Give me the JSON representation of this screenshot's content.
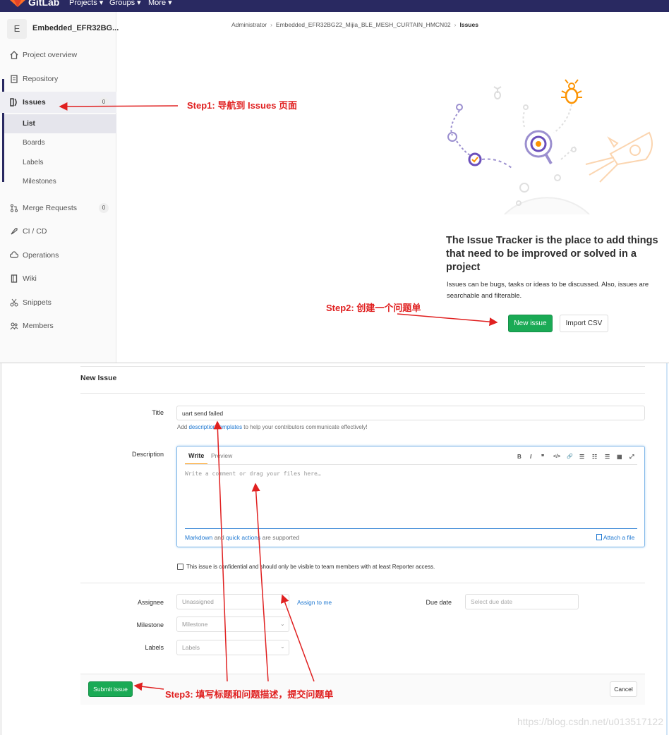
{
  "topnav": {
    "brand": "GitLab",
    "links": [
      "Projects ▾",
      "Groups ▾",
      "More ▾"
    ]
  },
  "sidebar": {
    "project_avatar": "E",
    "project_name": "Embedded_EFR32BG...",
    "items": [
      {
        "label": "Project overview"
      },
      {
        "label": "Repository"
      },
      {
        "label": "Issues",
        "badge": "0"
      },
      {
        "label": "Merge Requests",
        "badge": "0"
      },
      {
        "label": "CI / CD"
      },
      {
        "label": "Operations"
      },
      {
        "label": "Wiki"
      },
      {
        "label": "Snippets"
      },
      {
        "label": "Members"
      }
    ],
    "issues_sub": [
      "List",
      "Boards",
      "Labels",
      "Milestones"
    ]
  },
  "breadcrumb": {
    "items": [
      "Administrator",
      "Embedded_EFR32BG22_Mijia_BLE_MESH_CURTAIN_HMCN02",
      "Issues"
    ]
  },
  "empty_state": {
    "title": "The Issue Tracker is the place to add things that need to be improved or solved in a project",
    "description": "Issues can be bugs, tasks or ideas to be discussed. Also, issues are searchable and filterable.",
    "new_issue_label": "New issue",
    "import_label": "Import CSV"
  },
  "annotations": {
    "step1": "Step1: 导航到 Issues 页面",
    "step2": "Step2: 创建一个问题单",
    "step3": "Step3: 填写标题和问题描述，提交问题单"
  },
  "form": {
    "heading": "New Issue",
    "title_label": "Title",
    "title_value": "uart send failed",
    "title_hint_pre": "Add ",
    "title_hint_link": "description templates",
    "title_hint_post": " to help your contributors communicate effectively!",
    "description_label": "Description",
    "tab_write": "Write",
    "tab_preview": "Preview",
    "description_placeholder": "Write a comment or drag your files here…",
    "markdown_link": "Markdown",
    "and_text": " and ",
    "quick_actions_link": "quick actions",
    "supported_text": " are supported",
    "attach_label": "Attach a file",
    "confidential_label": "This issue is confidential and should only be visible to team members with at least Reporter access.",
    "assignee_label": "Assignee",
    "assignee_value": "Unassigned",
    "assign_to_me": "Assign to me",
    "due_date_label": "Due date",
    "due_date_placeholder": "Select due date",
    "milestone_label": "Milestone",
    "milestone_value": "Milestone",
    "labels_label": "Labels",
    "labels_value": "Labels",
    "submit_label": "Submit issue",
    "cancel_label": "Cancel"
  },
  "toolbar_glyphs": [
    "B",
    "I",
    "❞",
    "</>",
    "🔗",
    "☰",
    "☷",
    "☰",
    "▦",
    "⤢"
  ],
  "watermark": "https://blog.csdn.net/u013517122",
  "colors": {
    "nav": "#292961",
    "primary_green": "#1aaa55",
    "link": "#1f78d1",
    "annotation": "#e02020"
  }
}
